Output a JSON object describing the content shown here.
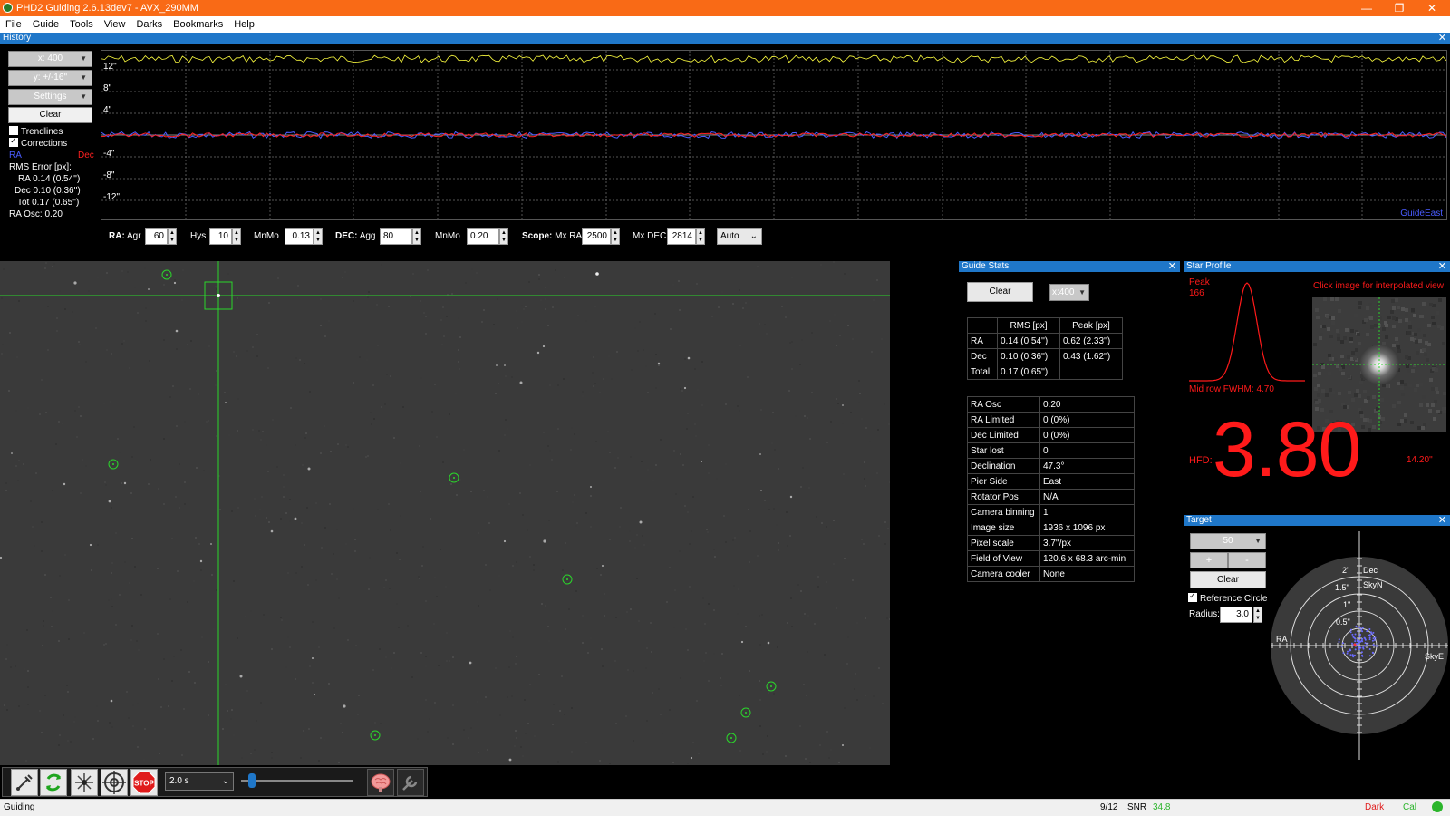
{
  "window": {
    "title": "PHD2 Guiding 2.6.13dev7 - AVX_290MM"
  },
  "menu": [
    "File",
    "Guide",
    "Tools",
    "View",
    "Darks",
    "Bookmarks",
    "Help"
  ],
  "history": {
    "title": "History",
    "x_scale": "x: 400",
    "y_scale": "y: +/-16''",
    "settings": "Settings",
    "clear": "Clear",
    "trendlines": "Trendlines",
    "corrections": "Corrections",
    "ra_label": "RA",
    "dec_label": "Dec",
    "rms_header": "RMS Error [px]:",
    "rms_ra": "RA 0.14 (0.54'')",
    "rms_dec": "Dec 0.10 (0.36'')",
    "rms_tot": "Tot 0.17 (0.65'')",
    "ra_osc": "RA Osc: 0.20",
    "y_ticks": [
      "12\"",
      "8\"",
      "4\"",
      "-4\"",
      "-8\"",
      "-12\""
    ],
    "guide_east": "GuideEast",
    "colors": {
      "ra": "#4a5cff",
      "dec": "#ff2020",
      "snr": "#ffff40"
    }
  },
  "controls": {
    "ra_label": "RA:",
    "agr_label": "Agr",
    "agr": "60",
    "hys_label": "Hys",
    "hys": "10",
    "mnmo_label": "MnMo",
    "ra_mnmo": "0.13",
    "dec_label": "DEC:",
    "agg_label": "Agg",
    "dec_agg": "80",
    "dec_mnmo": "0.20",
    "scope_label": "Scope:",
    "mxra_label": "Mx RA",
    "mx_ra": "2500",
    "mxdec_label": "Mx DEC",
    "mx_dec": "2814",
    "mode": "Auto"
  },
  "guide_stats": {
    "title": "Guide Stats",
    "clear": "Clear",
    "x_scale": "x:400",
    "rms_headers": [
      "",
      "RMS [px]",
      "Peak [px]"
    ],
    "rms_rows": [
      [
        "RA",
        "0.14 (0.54'')",
        "0.62 (2.33'')"
      ],
      [
        "Dec",
        "0.10 (0.36'')",
        "0.43 (1.62'')"
      ],
      [
        "Total",
        "0.17 (0.65'')",
        ""
      ]
    ],
    "info_rows": [
      [
        "RA Osc",
        "0.20"
      ],
      [
        "RA Limited",
        "0 (0%)"
      ],
      [
        "Dec Limited",
        "0 (0%)"
      ],
      [
        "Star lost",
        "0"
      ],
      [
        "Declination",
        "47.3°"
      ],
      [
        "Pier Side",
        "East"
      ],
      [
        "Rotator Pos",
        "N/A"
      ],
      [
        "Camera binning",
        "1"
      ],
      [
        "Image size",
        "1936 x 1096 px"
      ],
      [
        "Pixel scale",
        "3.7''/px"
      ],
      [
        "Field of View",
        "120.6 x 68.3 arc-min"
      ],
      [
        "Camera cooler",
        "None"
      ]
    ]
  },
  "star_profile": {
    "title": "Star Profile",
    "peak_label": "Peak",
    "peak_value": "166",
    "hint": "Click image for interpolated view",
    "fwhm": "Mid row FWHM: 4.70",
    "hfd_label": "HFD:",
    "hfd_value": "3.80",
    "hfd_arcsec": "14.20''",
    "color": "#ff1a1a"
  },
  "target": {
    "title": "Target",
    "scale": "50",
    "plus": "+",
    "minus": "-",
    "clear": "Clear",
    "ref_circle": "Reference Circle",
    "radius_label": "Radius:",
    "radius": "3.0",
    "ring_labels": [
      "2\"",
      "1.5\"",
      "1\"",
      "0.5\""
    ],
    "dec_label": "Dec",
    "skyn_label": "SkyN",
    "ra_label": "RA",
    "skye_label": "SkyE"
  },
  "toolbar": {
    "exposure": "2.0 s",
    "icons": [
      "usb-icon",
      "loop-icon",
      "auto-select-star-icon",
      "guide-target-icon",
      "stop-icon",
      "brain-icon",
      "tools-icon"
    ],
    "stop_text": "STOP"
  },
  "status": {
    "state": "Guiding",
    "frame": "9/12",
    "snr_label": "SNR",
    "snr_value": "34.8",
    "dark": "Dark",
    "cal": "Cal"
  }
}
